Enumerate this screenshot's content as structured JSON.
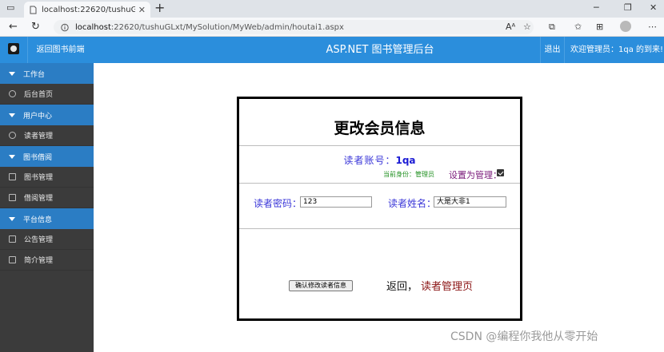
{
  "browser": {
    "tab_title": "localhost:22620/tushuGLxt/MySo",
    "tab_close": "✕",
    "new_tab": "+",
    "url_host": "localhost",
    "url_rest": ":22620/tushuGLxt/MySolution/MyWeb/admin/houtai1.aspx",
    "read_aloud": "Aᴬ",
    "win_min": "─",
    "win_max": "❐",
    "win_close": "✕"
  },
  "header": {
    "back_label": "返回图书前端",
    "title": "ASP.NET 图书管理后台",
    "logout_label": "退出",
    "welcome": "欢迎管理员：1qa 的到来!"
  },
  "sidebar": {
    "items": [
      {
        "label": "工作台",
        "kind": "head"
      },
      {
        "label": "后台首页",
        "kind": "link",
        "icon": "round"
      },
      {
        "label": "用户中心",
        "kind": "head"
      },
      {
        "label": "读者管理",
        "kind": "link",
        "icon": "round"
      },
      {
        "label": "图书借阅",
        "kind": "head"
      },
      {
        "label": "图书管理",
        "kind": "link",
        "icon": "rect"
      },
      {
        "label": "借阅管理",
        "kind": "link",
        "icon": "rect"
      },
      {
        "label": "平台信息",
        "kind": "head"
      },
      {
        "label": "公告管理",
        "kind": "link",
        "icon": "rect"
      },
      {
        "label": "简介管理",
        "kind": "link",
        "icon": "rect"
      }
    ]
  },
  "form": {
    "title": "更改会员信息",
    "account_label": "读者账号：",
    "account_value": "1qa",
    "identity_text": "当前身份：管理员",
    "admin_label": "设置为管理：",
    "admin_checked": true,
    "password_label": "读者密码：",
    "password_value": "123",
    "name_label": "读者姓名：",
    "name_value": "大是大非1",
    "submit_label": "确认修改读者信息",
    "back_text": "返回，",
    "back_link": "读者管理页"
  },
  "watermark": "CSDN @编程你我他从零开始"
}
